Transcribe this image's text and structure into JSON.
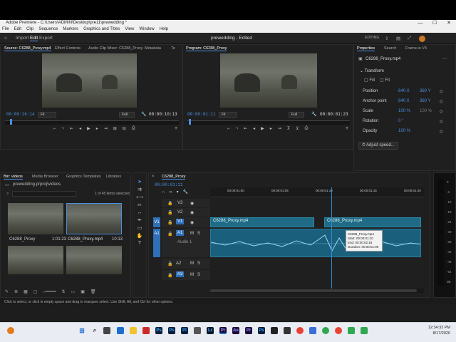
{
  "window": {
    "title": "Adobe Premiere - C:\\Users\\ADMIN\\Desktop\\pre11\\prewedding *",
    "project_name": "prewedding - Edited"
  },
  "menu": [
    "File",
    "Edit",
    "Clip",
    "Sequence",
    "Markers",
    "Graphics and Titles",
    "View",
    "Window",
    "Help"
  ],
  "appbar": {
    "import": "Import",
    "edit": "Edit",
    "export": "Export",
    "editing": "EDITING"
  },
  "source": {
    "tabs": [
      "Source: C6288_Proxy.mp4",
      "Effect Controls",
      "Audio Clip Mixer: C6288_Proxy",
      "Metadata",
      "Te"
    ],
    "timecode_in": "00:00:16:14",
    "fit": "Fit",
    "quality": "Full",
    "timecode_out": "00:00:10:13"
  },
  "program": {
    "tab": "Program: C6288_Proxy",
    "timecode_in": "00:00:01:11",
    "fit": "Fit",
    "quality": "Full",
    "timecode_out": "00:00:01:23"
  },
  "properties": {
    "tabs": [
      "Properties",
      "Search",
      "Frame.io V4"
    ],
    "clip_name": "C6288_Proxy.mp4",
    "section": "Transform",
    "fill": "Fill",
    "fit": "Fit",
    "rows": [
      {
        "label": "Position",
        "v1": "640 X",
        "v2": "360 Y"
      },
      {
        "label": "Anchor point",
        "v1": "640 X",
        "v2": "360 Y"
      },
      {
        "label": "Scale",
        "v1": "100 %",
        "v2": "100 %"
      },
      {
        "label": "Rotation",
        "v1": "0 °",
        "v2": ""
      },
      {
        "label": "Opacity",
        "v1": "100 %",
        "v2": ""
      }
    ],
    "adjust_speed": "Adjust speed..."
  },
  "project": {
    "tabs": [
      "Bin: videos",
      "Media Browser",
      "Graphics Templates",
      "Libraries"
    ],
    "path": "prewedding.prproj\\videos",
    "count": "1 of 45 items selected",
    "items": [
      {
        "name": "C6288_Proxy",
        "duration": "1:01:23"
      },
      {
        "name": "C6288_Proxy.mp4",
        "duration": "10:13"
      }
    ]
  },
  "timeline": {
    "tab": "C6288_Proxy",
    "timecode": "00:00:01:11",
    "ruler": [
      "00:00:01:00",
      "00:00:01:05",
      "00:00:01:10",
      "00:00:01:15",
      "00:00:01:20"
    ],
    "tracks": [
      "V3",
      "V2",
      "V1",
      "A1",
      "A2",
      "A3"
    ],
    "source_patch": [
      "V1",
      "A1"
    ],
    "audio_label": "Audio 1",
    "clip1": "C6288_Proxy.mp4",
    "clip2": "C6288_Proxy.mp4",
    "tooltip": {
      "name": "C6288_Proxy.mp4",
      "start": "Start: 00:00:01:10",
      "end": "End: 00:00:02:18",
      "duration": "Duration: 00:00:01:09"
    },
    "meter_ticks": [
      "0",
      "-6",
      "-12",
      "-18",
      "-24",
      "-30",
      "-36",
      "-42",
      "-48",
      "-54",
      "dB"
    ]
  },
  "status": "Click to select, or click in empty space and drag to marquee select. Use Shift, Alt, and Ctrl for other options.",
  "taskbar": {
    "time": "12:34:32 PM",
    "date": "8/17/2026"
  },
  "colors": {
    "accent": "#4a90e2",
    "clip": "#1f6b85",
    "playhead": "#2e8bd6"
  }
}
